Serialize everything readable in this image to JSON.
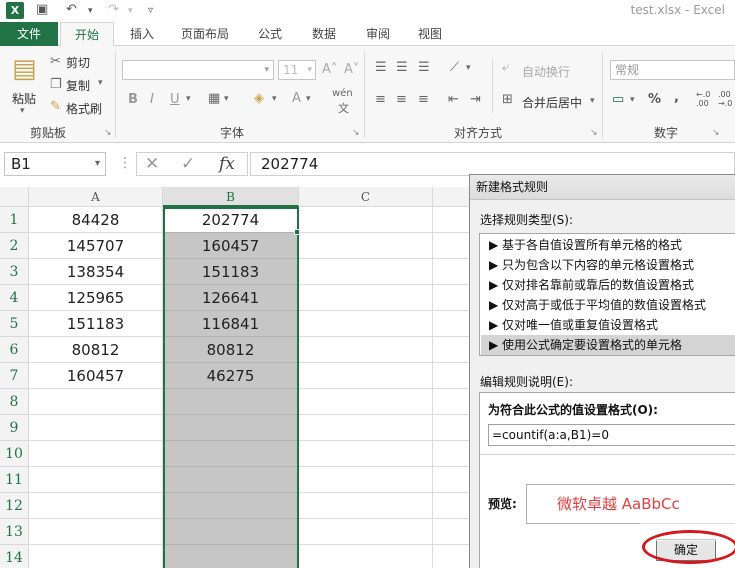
{
  "window": {
    "title": "test.xlsx - Excel"
  },
  "ribbon": {
    "tabs": {
      "file": "文件",
      "home": "开始",
      "insert": "插入",
      "layout": "页面布局",
      "formulas": "公式",
      "data": "数据",
      "review": "审阅",
      "view": "视图"
    },
    "clipboard": {
      "paste": "粘贴",
      "cut": "剪切",
      "copy": "复制",
      "painter": "格式刷",
      "group": "剪贴板"
    },
    "font": {
      "size": "11",
      "group": "字体",
      "bold": "B",
      "italic": "I",
      "underline": "U",
      "color_a": "A",
      "wen": "wén"
    },
    "align": {
      "wrap": "自动换行",
      "merge": "合并后居中",
      "group": "对齐方式"
    },
    "number": {
      "format": "常规",
      "percent": "%",
      "comma": ",",
      "group": "数字",
      "dec_inc": "←.0 .00",
      "dec_dec": ".00 →.0"
    }
  },
  "formula_bar": {
    "name_box": "B1",
    "value": "202774",
    "fx": "fx"
  },
  "sheet": {
    "columns": [
      "A",
      "B",
      "C"
    ],
    "rows": [
      "1",
      "2",
      "3",
      "4",
      "5",
      "6",
      "7",
      "8",
      "9",
      "10",
      "11",
      "12",
      "13",
      "14"
    ],
    "col_a": [
      "84428",
      "145707",
      "138354",
      "125965",
      "151183",
      "80812",
      "160457",
      "",
      "",
      "",
      "",
      "",
      "",
      ""
    ],
    "col_b": [
      "202774",
      "160457",
      "151183",
      "126641",
      "116841",
      "80812",
      "46275",
      "",
      "",
      "",
      "",
      "",
      "",
      ""
    ]
  },
  "dialog": {
    "title": "新建格式规则",
    "select_label": "选择规则类型(S):",
    "rule_types": [
      "▶ 基于各自值设置所有单元格的格式",
      "▶ 只为包含以下内容的单元格设置格式",
      "▶ 仅对排名靠前或靠后的数值设置格式",
      "▶ 仅对高于或低于平均值的数值设置格式",
      "▶ 仅对唯一值或重复值设置格式",
      "▶ 使用公式确定要设置格式的单元格"
    ],
    "edit_label": "编辑规则说明(E):",
    "formula_head": "为符合此公式的值设置格式(O):",
    "formula": "=countif(a:a,B1)=0",
    "preview_label": "预览:",
    "preview_text": "微软卓越  AaBbCc",
    "ok": "确定"
  }
}
